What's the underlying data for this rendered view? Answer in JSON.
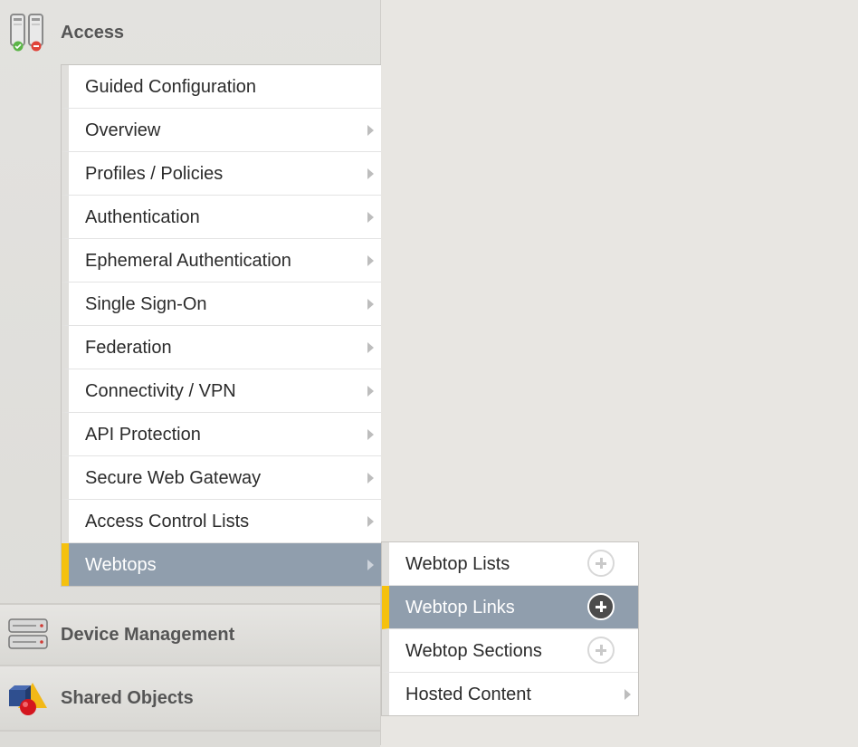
{
  "nav": {
    "access": {
      "label": "Access",
      "icon": "access-icon"
    },
    "device_management": {
      "label": "Device Management",
      "icon": "server-icon"
    },
    "shared_objects": {
      "label": "Shared Objects",
      "icon": "shapes-icon"
    }
  },
  "main_menu": {
    "items": [
      {
        "label": "Guided Configuration",
        "has_submenu": false
      },
      {
        "label": "Overview",
        "has_submenu": true
      },
      {
        "label": "Profiles / Policies",
        "has_submenu": true
      },
      {
        "label": "Authentication",
        "has_submenu": true
      },
      {
        "label": "Ephemeral Authentication",
        "has_submenu": true
      },
      {
        "label": "Single Sign-On",
        "has_submenu": true
      },
      {
        "label": "Federation",
        "has_submenu": true
      },
      {
        "label": "Connectivity / VPN",
        "has_submenu": true
      },
      {
        "label": "API Protection",
        "has_submenu": true
      },
      {
        "label": "Secure Web Gateway",
        "has_submenu": true
      },
      {
        "label": "Access Control Lists",
        "has_submenu": true
      },
      {
        "label": "Webtops",
        "has_submenu": true,
        "active": true
      }
    ]
  },
  "sub_menu": {
    "items": [
      {
        "label": "Webtop Lists",
        "action": "plus"
      },
      {
        "label": "Webtop Links",
        "action": "plus",
        "active": true
      },
      {
        "label": "Webtop Sections",
        "action": "plus"
      },
      {
        "label": "Hosted Content",
        "action": "arrow"
      }
    ]
  },
  "colors": {
    "active_bg": "#909ead",
    "active_marker": "#f5c10e",
    "page_bg": "#e8e6e2"
  }
}
